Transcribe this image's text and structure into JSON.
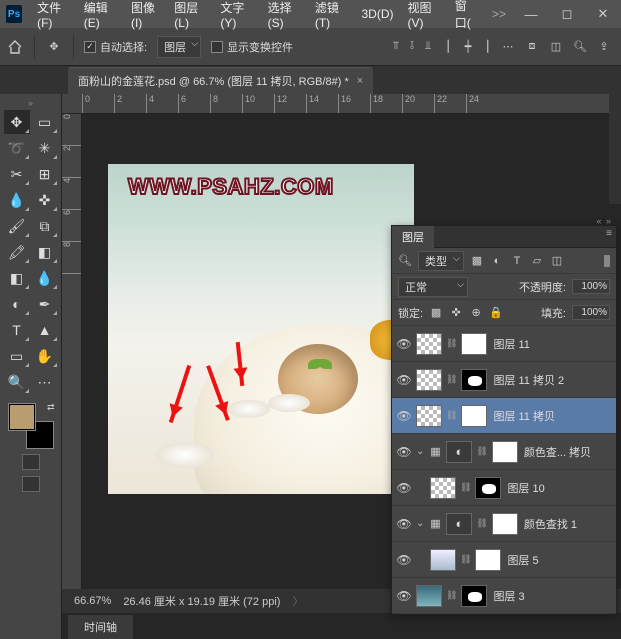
{
  "menubar": [
    "文件(F)",
    "编辑(E)",
    "图像(I)",
    "图层(L)",
    "文字(Y)",
    "选择(S)",
    "滤镜(T)",
    "3D(D)",
    "视图(V)",
    "窗口(",
    ">>"
  ],
  "optbar": {
    "auto_select_label": "自动选择:",
    "target": "图层",
    "show_controls_label": "显示变换控件"
  },
  "tab": {
    "title": "面粉山的金莲花.psd @ 66.7% (图层 11 拷贝, RGB/8#) *",
    "close": "×"
  },
  "ruler_top": [
    "0",
    "2",
    "4",
    "6",
    "8",
    "10",
    "12",
    "14",
    "16",
    "18",
    "20",
    "22",
    "24"
  ],
  "ruler_left": [
    "0",
    "2",
    "4",
    "6",
    "8"
  ],
  "artboard_text": "WWW.PSAHZ.COM",
  "status": {
    "zoom": "66.67%",
    "docinfo": "26.46 厘米 x 19.19 厘米 (72 ppi)",
    "arrow": "〉"
  },
  "timeline_label": "时间轴",
  "layers": {
    "tab": "图层",
    "type_label": "类型",
    "blend_mode": "正常",
    "opacity_label": "不透明度:",
    "opacity_value": "100%",
    "lock_label": "锁定:",
    "fill_label": "填充:",
    "fill_value": "100%",
    "items": [
      {
        "name": "图层 11",
        "thumb": "checker",
        "mask": "mask",
        "eye": true,
        "link": ""
      },
      {
        "name": "图层 11 拷贝 2",
        "thumb": "checker",
        "mask": "maskdark",
        "eye": true,
        "link": ""
      },
      {
        "name": "图层 11 拷贝",
        "thumb": "checker",
        "mask": "mask",
        "eye": true,
        "link": "",
        "selected": true
      },
      {
        "name": "颜色查... 拷贝",
        "thumb": "adj",
        "mask": "mask",
        "eye": true,
        "link": "⌄",
        "grp": true
      },
      {
        "name": "图层 10",
        "thumb": "checker",
        "mask": "maskdark",
        "eye": true,
        "link": "",
        "under": true
      },
      {
        "name": "颜色查找 1",
        "thumb": "adj",
        "mask": "mask",
        "eye": true,
        "link": "⌄",
        "grp": true
      },
      {
        "name": "图层 5",
        "thumb": "clouds",
        "mask": "mask",
        "eye": true,
        "link": "",
        "under": true
      },
      {
        "name": "图层 3",
        "thumb": "sky",
        "mask": "maskdark",
        "eye": true,
        "link": ""
      }
    ]
  }
}
